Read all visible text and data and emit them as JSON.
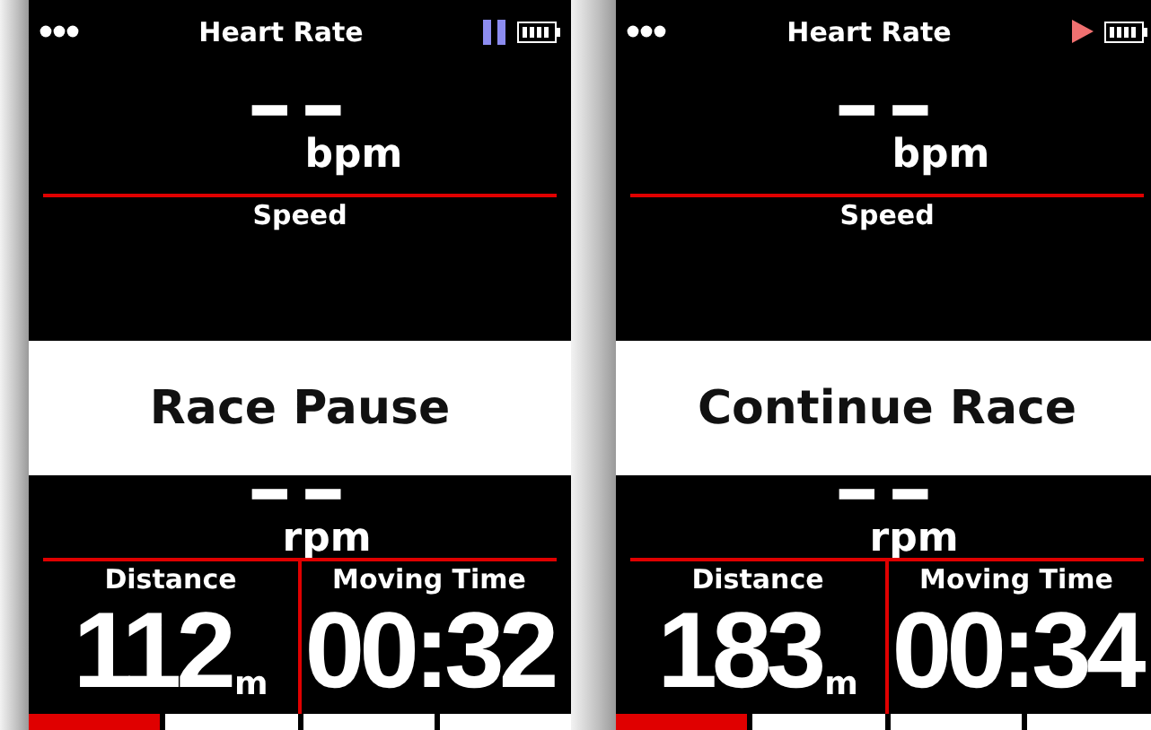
{
  "screens": [
    {
      "title": "Heart Rate",
      "paused": true,
      "heart_rate": {
        "value": "--",
        "unit": "bpm"
      },
      "speed": {
        "label": "Speed"
      },
      "banner": "Race Pause",
      "cadence": {
        "value": "--",
        "unit": "rpm"
      },
      "cells": [
        {
          "label": "Distance",
          "value": "112",
          "unit": "m"
        },
        {
          "label": "Moving Time",
          "value": "00:32"
        }
      ],
      "pages": [
        {
          "selected": true
        },
        {
          "selected": false
        },
        {
          "selected": false
        },
        {
          "selected": false
        }
      ]
    },
    {
      "title": "Heart Rate",
      "paused": false,
      "heart_rate": {
        "value": "--",
        "unit": "bpm"
      },
      "speed": {
        "label": "Speed"
      },
      "banner": "Continue Race",
      "cadence": {
        "value": "--",
        "unit": "rpm"
      },
      "cells": [
        {
          "label": "Distance",
          "value": "183",
          "unit": "m"
        },
        {
          "label": "Moving Time",
          "value": "00:34"
        }
      ],
      "pages": [
        {
          "selected": true
        },
        {
          "selected": false
        },
        {
          "selected": false
        },
        {
          "selected": false
        }
      ]
    }
  ]
}
